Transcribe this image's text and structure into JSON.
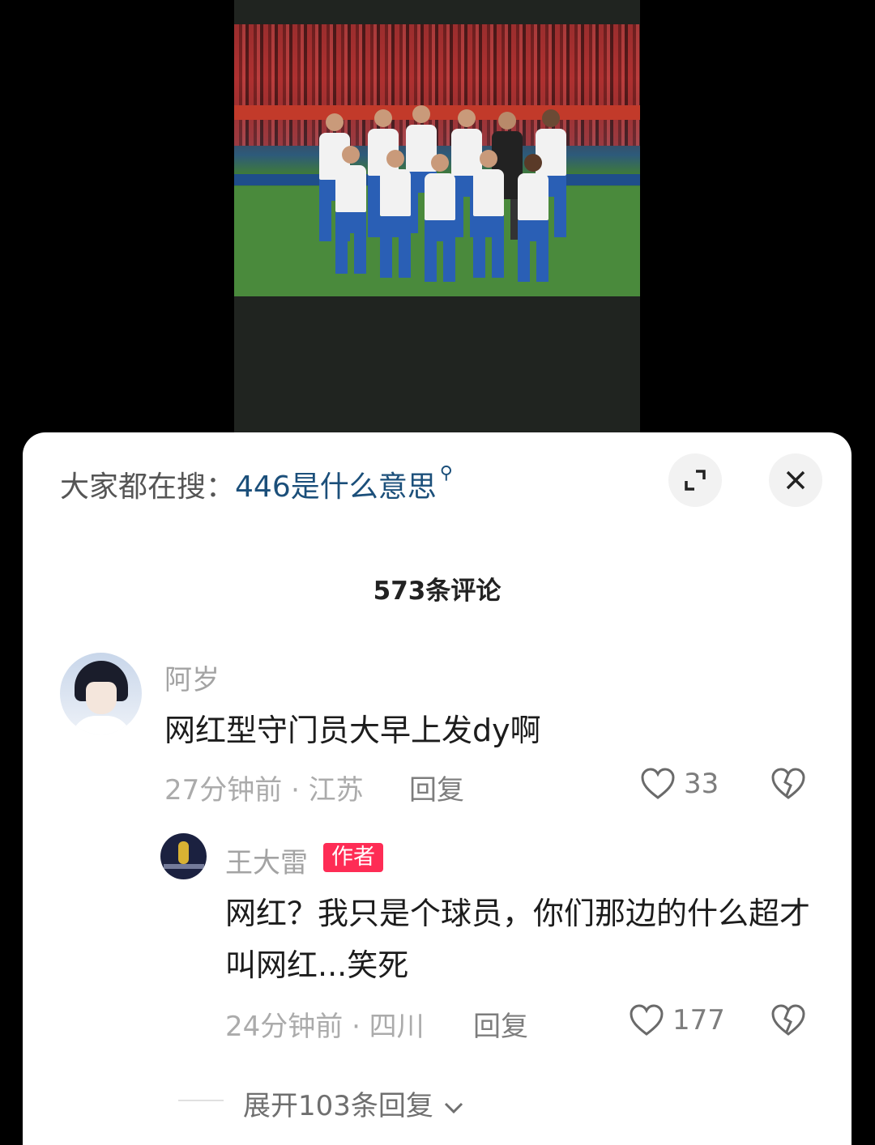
{
  "header": {
    "search_prefix": "大家都在搜：",
    "search_keyword": "446是什么意思"
  },
  "comments_title": "573条评论",
  "comments": [
    {
      "username": "阿岁",
      "text": "网红型守门员大早上发dy啊",
      "time_location": "27分钟前 · 江苏",
      "reply_label": "回复",
      "likes": "33"
    }
  ],
  "reply": {
    "username": "王大雷",
    "badge": "作者",
    "text": "网红？我只是个球员，你们那边的什么超才叫网红...笑死",
    "time_location": "24分钟前 · 四川",
    "reply_label": "回复",
    "likes": "177"
  },
  "expand_replies_label": "展开103条回复",
  "colors": {
    "keyword": "#1b4f7a",
    "author_badge": "#fe2c55"
  },
  "icons": [
    "search-icon",
    "expand-icon",
    "close-icon",
    "heart-icon",
    "broken-heart-icon",
    "chevron-down-icon"
  ]
}
